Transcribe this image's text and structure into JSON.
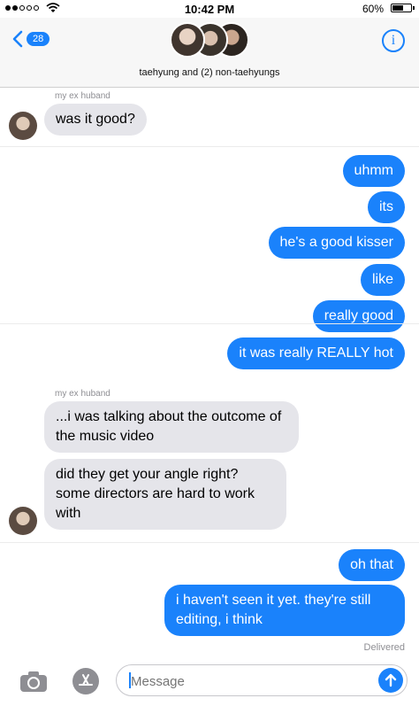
{
  "status_bar": {
    "time": "10:42 PM",
    "battery": "60%",
    "battery_level": 0.6
  },
  "header": {
    "back_count": "28",
    "group_name": "taehyung and (2) non-taehyungs",
    "info_glyph": "i"
  },
  "messages": [
    {
      "dir": "in",
      "sender": "my ex huband",
      "text": "was it good?"
    },
    {
      "dir": "out",
      "text": "uhmm"
    },
    {
      "dir": "out",
      "text": "its"
    },
    {
      "dir": "out",
      "text": "he's a good kisser"
    },
    {
      "dir": "out",
      "text": "like"
    },
    {
      "dir": "out",
      "text": "really good"
    },
    {
      "dir": "out",
      "text": "it was really REALLY hot"
    },
    {
      "dir": "in",
      "sender": "my ex huband",
      "text": "...i was talking about the outcome of the music video"
    },
    {
      "dir": "in",
      "text": "did they get your angle right? some directors are hard to work with"
    },
    {
      "dir": "out",
      "text": "oh that"
    },
    {
      "dir": "out",
      "text": "i haven't seen it yet. they're still editing, i think"
    }
  ],
  "delivered_label": "Delivered",
  "input": {
    "placeholder": "Message"
  },
  "colors": {
    "accent": "#1a82fb",
    "incoming_bubble": "#e5e5ea",
    "timestamp_gray": "#8e8e93"
  },
  "icons": [
    "back-chevron-icon",
    "info-icon",
    "camera-icon",
    "app-store-icon",
    "send-arrow-icon",
    "wifi-icon",
    "battery-icon"
  ]
}
